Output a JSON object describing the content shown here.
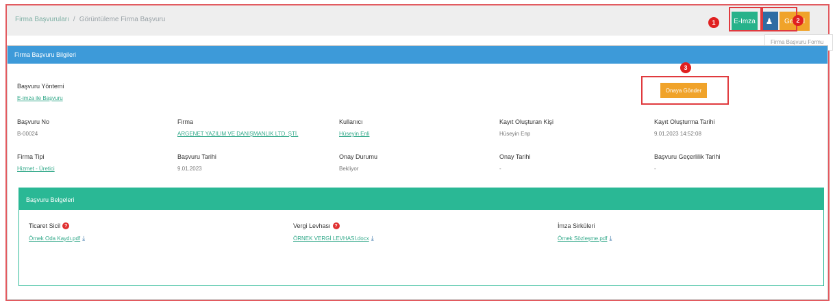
{
  "breadcrumb": {
    "parent": "Firma Başvuruları",
    "separator": "/",
    "current": "Görüntüleme Firma Başvuru"
  },
  "toolbar": {
    "green_label": "E-Imza",
    "blue_icon": "person-sign-icon",
    "orange_label": "Geri Al"
  },
  "markers": [
    "1",
    "2",
    "3"
  ],
  "dropdown_hint": "Firma Başvuru Formu",
  "panel": {
    "title": "Firma Başvuru Bilgileri",
    "yontem_label": "Başvuru Yöntemi",
    "yontem_value": "E-imza ile Başvuru",
    "action_button": "Onaya Gönder",
    "row1": [
      {
        "label": "Başvuru No",
        "value": "B-00024",
        "link": false
      },
      {
        "label": "Firma",
        "value": "ARGENET YAZILIM VE DANIŞMANLIK LTD. ŞTİ.",
        "link": true
      },
      {
        "label": "Kullanıcı",
        "value": "Hüseyin Enli",
        "link": true
      },
      {
        "label": "Kayıt Oluşturan Kişi",
        "value": "Hüseyin Enp",
        "link": false
      },
      {
        "label": "Kayıt Oluşturma Tarihi",
        "value": "9.01.2023 14:52:08",
        "link": false
      }
    ],
    "row2": [
      {
        "label": "Firma Tipi",
        "value": "Hizmet - Üretici",
        "link": true
      },
      {
        "label": "Başvuru Tarihi",
        "value": "9.01.2023",
        "link": false
      },
      {
        "label": "Onay Durumu",
        "value": "Bekliyor",
        "link": false
      },
      {
        "label": "Onay Tarihi",
        "value": "-",
        "link": false
      },
      {
        "label": "Başvuru Geçerlilik Tarihi",
        "value": "-",
        "link": false
      }
    ]
  },
  "docs": {
    "title": "Başvuru Belgeleri",
    "items": [
      {
        "label": "Ticaret Sicil",
        "file": "Örnek Oda Kaydı.pdf",
        "required": true
      },
      {
        "label": "Vergi Levhası",
        "file": "ÖRNEK VERGİ LEVHASI.docx",
        "required": true
      },
      {
        "label": "İmza Sirküleri",
        "file": "Örnek Sözleşme.pdf",
        "required": false
      }
    ]
  },
  "colors": {
    "accent_blue": "#3d9ad9",
    "accent_green": "#2ab895",
    "accent_orange": "#f0a32a",
    "highlight_red": "#e03a3e"
  }
}
